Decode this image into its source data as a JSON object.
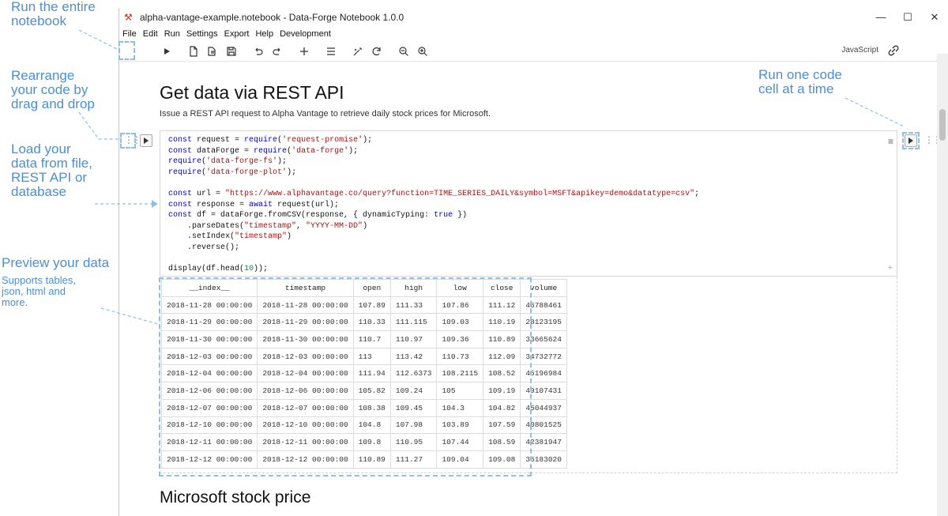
{
  "annotations": {
    "run_notebook": [
      "Run the entire",
      "notebook"
    ],
    "rearrange": [
      "Rearrange",
      "your code by",
      "drag and drop"
    ],
    "load": [
      "Load your",
      "data from file,",
      "REST API or",
      "database"
    ],
    "preview_title": "Preview your data",
    "preview_sub": [
      "Supports tables,",
      "json, html and",
      "more."
    ],
    "run_cell": [
      "Run one code",
      "cell at a time"
    ]
  },
  "window": {
    "title": "alpha-vantage-example.notebook - Data-Forge Notebook 1.0.0",
    "controls": [
      "—",
      "☐",
      "✕"
    ]
  },
  "menu": [
    "File",
    "Edit",
    "Run",
    "Settings",
    "Export",
    "Help",
    "Development"
  ],
  "toolbar": {
    "icons": [
      "run-all-icon",
      "new-file-icon",
      "open-file-icon",
      "save-icon",
      "undo-icon",
      "redo-icon",
      "add-cell-icon",
      "menu-icon",
      "wand-icon",
      "refresh-icon",
      "zoom-out-icon",
      "zoom-in-icon"
    ],
    "language": "JavaScript"
  },
  "page": {
    "heading": "Get data via REST API",
    "description": "Issue a REST API request to Alpha Vantage to retrieve daily stock prices for Microsoft.",
    "next_heading": "Microsoft stock price"
  },
  "code_lines": [
    "const request = require('request-promise');",
    "const dataForge = require('data-forge');",
    "require('data-forge-fs');",
    "require('data-forge-plot');",
    "",
    "const url = \"https://www.alphavantage.co/query?function=TIME_SERIES_DAILY&symbol=MSFT&apikey=demo&datatype=csv\";",
    "const response = await request(url);",
    "const df = dataForge.fromCSV(response, { dynamicTyping: true })",
    "    .parseDates(\"timestamp\", \"YYYY-MM-DD\")",
    "    .setIndex(\"timestamp\")",
    "    .reverse();",
    "",
    "display(df.head(10));"
  ],
  "table": {
    "columns": [
      "__index__",
      "timestamp",
      "open",
      "high",
      "low",
      "close",
      "volume"
    ],
    "rows": [
      [
        "2018-11-28 00:00:00",
        "2018-11-28 00:00:00",
        "107.89",
        "111.33",
        "107.86",
        "111.12",
        "46788461"
      ],
      [
        "2018-11-29 00:00:00",
        "2018-11-29 00:00:00",
        "110.33",
        "111.115",
        "109.03",
        "110.19",
        "28123195"
      ],
      [
        "2018-11-30 00:00:00",
        "2018-11-30 00:00:00",
        "110.7",
        "110.97",
        "109.36",
        "110.89",
        "33665624"
      ],
      [
        "2018-12-03 00:00:00",
        "2018-12-03 00:00:00",
        "113",
        "113.42",
        "110.73",
        "112.09",
        "34732772"
      ],
      [
        "2018-12-04 00:00:00",
        "2018-12-04 00:00:00",
        "111.94",
        "112.6373",
        "108.2115",
        "108.52",
        "45196984"
      ],
      [
        "2018-12-06 00:00:00",
        "2018-12-06 00:00:00",
        "105.82",
        "109.24",
        "105",
        "109.19",
        "49107431"
      ],
      [
        "2018-12-07 00:00:00",
        "2018-12-07 00:00:00",
        "108.38",
        "109.45",
        "104.3",
        "104.82",
        "45044937"
      ],
      [
        "2018-12-10 00:00:00",
        "2018-12-10 00:00:00",
        "104.8",
        "107.98",
        "103.89",
        "107.59",
        "40801525"
      ],
      [
        "2018-12-11 00:00:00",
        "2018-12-11 00:00:00",
        "109.8",
        "110.95",
        "107.44",
        "108.59",
        "42381947"
      ],
      [
        "2018-12-12 00:00:00",
        "2018-12-12 00:00:00",
        "110.89",
        "111.27",
        "109.04",
        "109.08",
        "36183020"
      ]
    ]
  },
  "colors": {
    "annotation": "#4a8fd6",
    "keyword": "#0000cc",
    "string": "#a31515"
  }
}
